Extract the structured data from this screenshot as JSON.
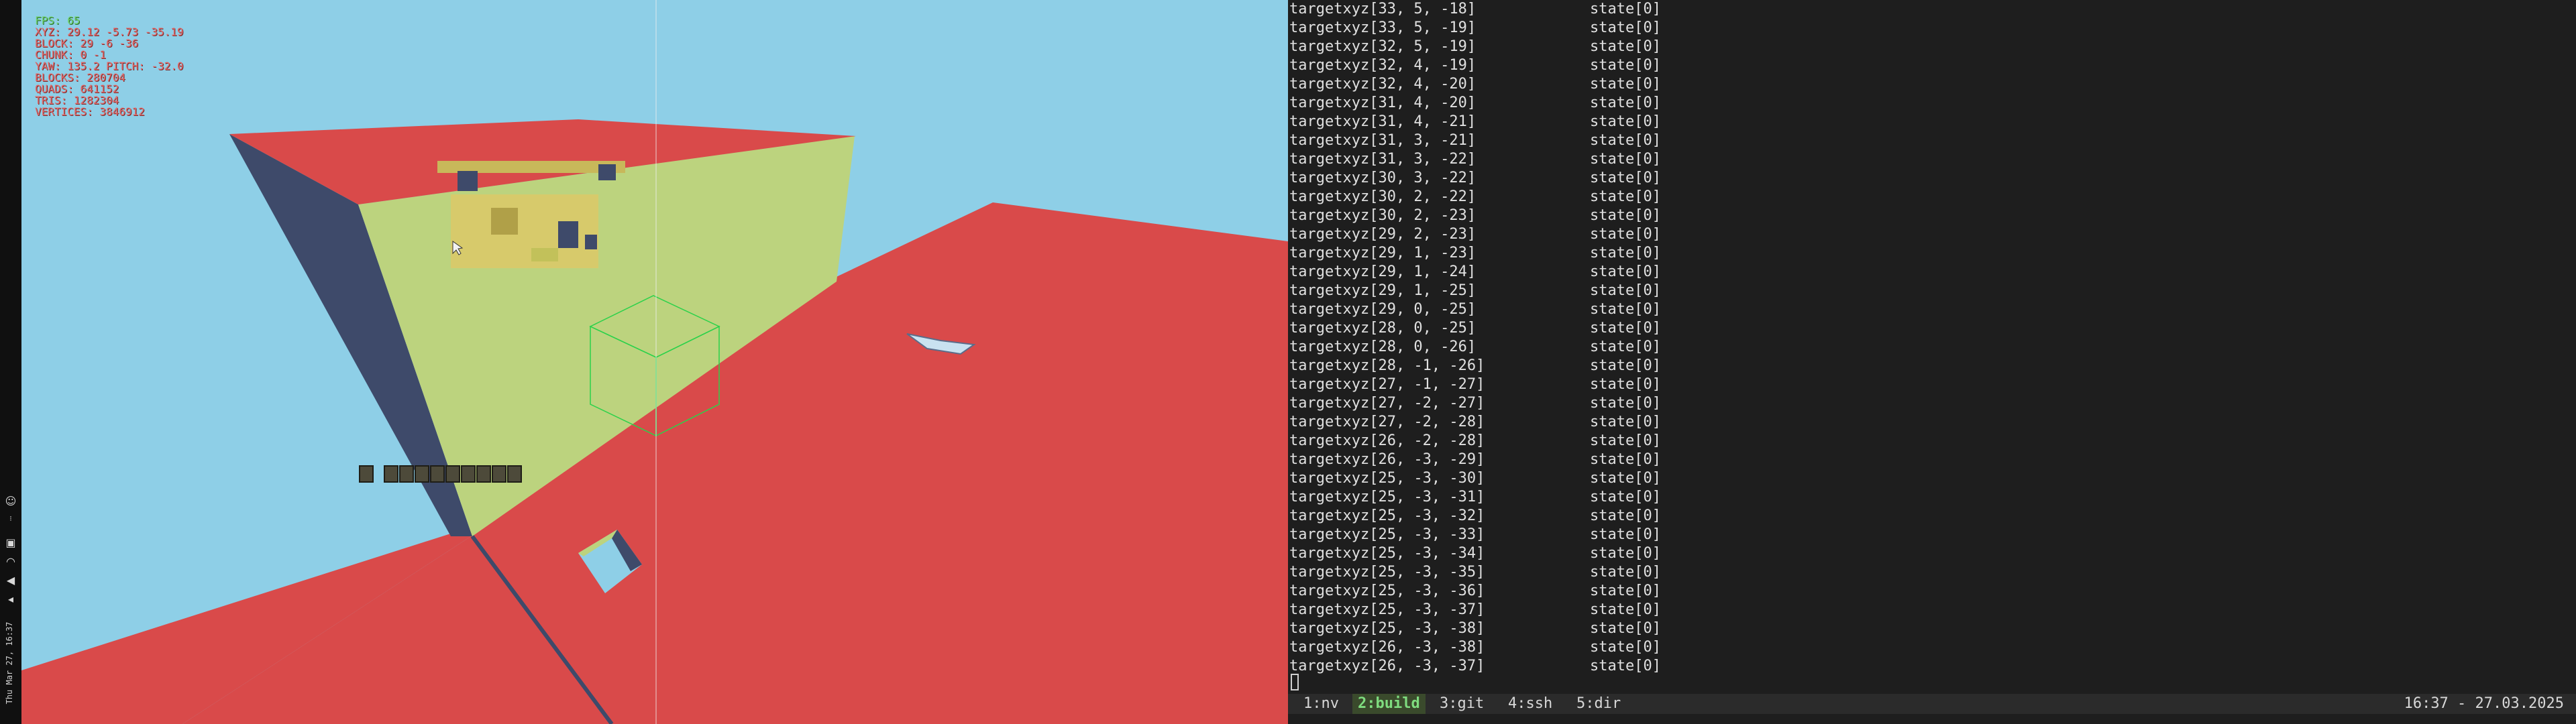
{
  "sysbar": {
    "date_text": "Thu Mar 27, 16:37"
  },
  "game": {
    "hud": {
      "fps": "FPS: 65",
      "xyz": "XYZ: 29.12 -5.73 -35.19",
      "block": "BLOCK: 29 -6 -36",
      "chunk": "CHUNK: 0 -1",
      "yaw": "YAW: 135.2 PITCH: -32.0",
      "blocks": "BLOCKS: 280704",
      "quads": "QUADS: 641152",
      "tris": "TRIS: 1282304",
      "vertices": "VERTICES: 3846912"
    },
    "colors": {
      "sky": "#8ecfe7",
      "red": "#d94a4a",
      "green": "#bcd37e",
      "navy": "#3e4a6a",
      "wireframe": "#2ad24a"
    }
  },
  "terminal": {
    "lines": [
      {
        "target": "targetxyz[33, 5, -18]",
        "state": "state[0]"
      },
      {
        "target": "targetxyz[33, 5, -19]",
        "state": "state[0]"
      },
      {
        "target": "targetxyz[32, 5, -19]",
        "state": "state[0]"
      },
      {
        "target": "targetxyz[32, 4, -19]",
        "state": "state[0]"
      },
      {
        "target": "targetxyz[32, 4, -20]",
        "state": "state[0]"
      },
      {
        "target": "targetxyz[31, 4, -20]",
        "state": "state[0]"
      },
      {
        "target": "targetxyz[31, 4, -21]",
        "state": "state[0]"
      },
      {
        "target": "targetxyz[31, 3, -21]",
        "state": "state[0]"
      },
      {
        "target": "targetxyz[31, 3, -22]",
        "state": "state[0]"
      },
      {
        "target": "targetxyz[30, 3, -22]",
        "state": "state[0]"
      },
      {
        "target": "targetxyz[30, 2, -22]",
        "state": "state[0]"
      },
      {
        "target": "targetxyz[30, 2, -23]",
        "state": "state[0]"
      },
      {
        "target": "targetxyz[29, 2, -23]",
        "state": "state[0]"
      },
      {
        "target": "targetxyz[29, 1, -23]",
        "state": "state[0]"
      },
      {
        "target": "targetxyz[29, 1, -24]",
        "state": "state[0]"
      },
      {
        "target": "targetxyz[29, 1, -25]",
        "state": "state[0]"
      },
      {
        "target": "targetxyz[29, 0, -25]",
        "state": "state[0]"
      },
      {
        "target": "targetxyz[28, 0, -25]",
        "state": "state[0]"
      },
      {
        "target": "targetxyz[28, 0, -26]",
        "state": "state[0]"
      },
      {
        "target": "targetxyz[28, -1, -26]",
        "state": "state[0]"
      },
      {
        "target": "targetxyz[27, -1, -27]",
        "state": "state[0]"
      },
      {
        "target": "targetxyz[27, -2, -27]",
        "state": "state[0]"
      },
      {
        "target": "targetxyz[27, -2, -28]",
        "state": "state[0]"
      },
      {
        "target": "targetxyz[26, -2, -28]",
        "state": "state[0]"
      },
      {
        "target": "targetxyz[26, -3, -29]",
        "state": "state[0]"
      },
      {
        "target": "targetxyz[25, -3, -30]",
        "state": "state[0]"
      },
      {
        "target": "targetxyz[25, -3, -31]",
        "state": "state[0]"
      },
      {
        "target": "targetxyz[25, -3, -32]",
        "state": "state[0]"
      },
      {
        "target": "targetxyz[25, -3, -33]",
        "state": "state[0]"
      },
      {
        "target": "targetxyz[25, -3, -34]",
        "state": "state[0]"
      },
      {
        "target": "targetxyz[25, -3, -35]",
        "state": "state[0]"
      },
      {
        "target": "targetxyz[25, -3, -36]",
        "state": "state[0]"
      },
      {
        "target": "targetxyz[25, -3, -37]",
        "state": "state[0]"
      },
      {
        "target": "targetxyz[25, -3, -38]",
        "state": "state[0]"
      },
      {
        "target": "targetxyz[26, -3, -38]",
        "state": "state[0]"
      },
      {
        "target": "targetxyz[26, -3, -37]",
        "state": "state[0]"
      }
    ],
    "status": {
      "windows": [
        {
          "label": "1:nv",
          "active": false
        },
        {
          "label": "2:build",
          "active": true
        },
        {
          "label": "3:git",
          "active": false
        },
        {
          "label": "4:ssh",
          "active": false
        },
        {
          "label": "5:dir",
          "active": false
        }
      ],
      "clock": "16:37 - 27.03.2025"
    }
  }
}
